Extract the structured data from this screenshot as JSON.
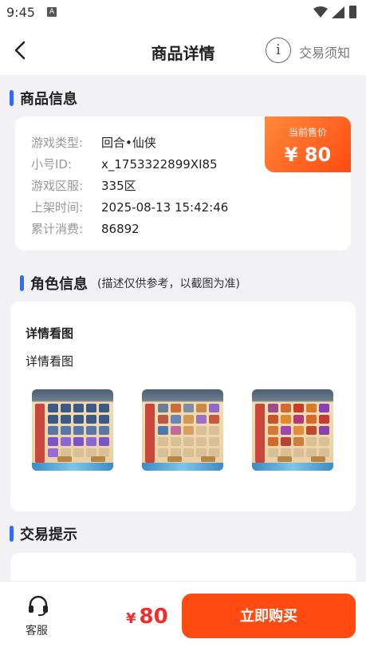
{
  "status_bar": {
    "time": "9:45",
    "badge": "A"
  },
  "nav": {
    "title": "商品详情",
    "info_glyph": "i",
    "notice": "交易须知"
  },
  "product_section": {
    "title": "商品信息"
  },
  "product_info": [
    {
      "key": "游戏类型:",
      "value": "回合•仙侠"
    },
    {
      "key": "小号ID:",
      "value": "x_1753322899XI85"
    },
    {
      "key": "游戏区服:",
      "value": "335区"
    },
    {
      "key": "上架时间:",
      "value": "2025-08-13 15:42:46"
    },
    {
      "key": "累计消费:",
      "value": "86892"
    }
  ],
  "price_tag": {
    "title": "当前售价",
    "value": "¥ 80"
  },
  "role_section": {
    "title": "角色信息",
    "subtitle": "(描述仅供参考，以截图为准)"
  },
  "role_card": {
    "heading": "详情看图",
    "subheading": "详情看图"
  },
  "screenshots": [
    "inventory-screenshot-1",
    "inventory-screenshot-2",
    "inventory-screenshot-3"
  ],
  "tips_section": {
    "title": "交易提示"
  },
  "bottom_bar": {
    "service_label": "客服",
    "price_symbol": "¥",
    "price_value": "80",
    "buy_label": "立即购买"
  },
  "colors": {
    "accent_blue": "#2f6bff",
    "accent_orange": "#ff4a12",
    "price_red": "#f22b2b"
  }
}
